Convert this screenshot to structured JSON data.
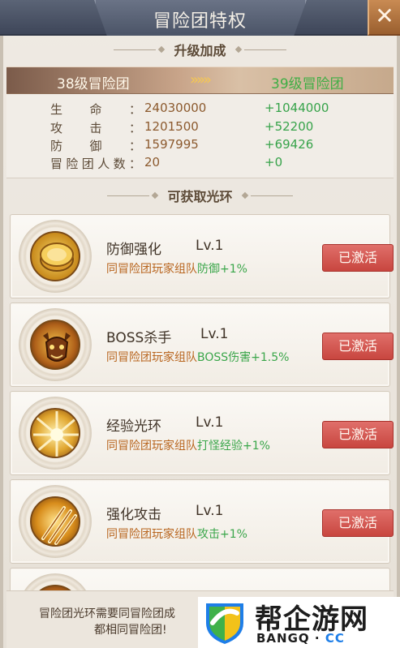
{
  "window": {
    "title": "冒险团特权",
    "close_label": "✕"
  },
  "upgrade": {
    "section_title": "升级加成",
    "from_level": "38级冒险团",
    "to_level": "39级冒险团",
    "arrows": "»»»",
    "stats": [
      {
        "label": "生命：",
        "value": "24030000",
        "increase": "+1044000"
      },
      {
        "label": "攻击：",
        "value": "1201500",
        "increase": "+52200"
      },
      {
        "label": "防御：",
        "value": "1597995",
        "increase": "+69426"
      },
      {
        "label": "冒险团人数：",
        "value": "20",
        "increase": "+0"
      }
    ]
  },
  "halos": {
    "section_title": "可获取光环",
    "items": [
      {
        "name": "防御强化",
        "level": "Lv.1",
        "desc_prefix": "同冒险团玩家组队",
        "desc_effect": "防御+1%",
        "status": "已激活",
        "icon": "shield-coin-icon"
      },
      {
        "name": "BOSS杀手",
        "level": "Lv.1",
        "desc_prefix": "同冒险团玩家组队",
        "desc_effect": "BOSS伤害+1.5%",
        "status": "已激活",
        "icon": "beast-head-icon"
      },
      {
        "name": "经验光环",
        "level": "Lv.1",
        "desc_prefix": "同冒险团玩家组队",
        "desc_effect": "打怪经验+1%",
        "status": "已激活",
        "icon": "light-rays-icon"
      },
      {
        "name": "强化攻击",
        "level": "Lv.1",
        "desc_prefix": "同冒险团玩家组队",
        "desc_effect": "攻击+1%",
        "status": "已激活",
        "icon": "claw-strike-icon"
      }
    ]
  },
  "footer": {
    "line1": "冒险团光环需要同冒险团成",
    "line2": "都相同冒险团!"
  },
  "watermark": {
    "brand": "帮企游网",
    "domain_prefix": "BANGQ",
    "domain_dot": " · ",
    "domain_suffix": "CC"
  }
}
